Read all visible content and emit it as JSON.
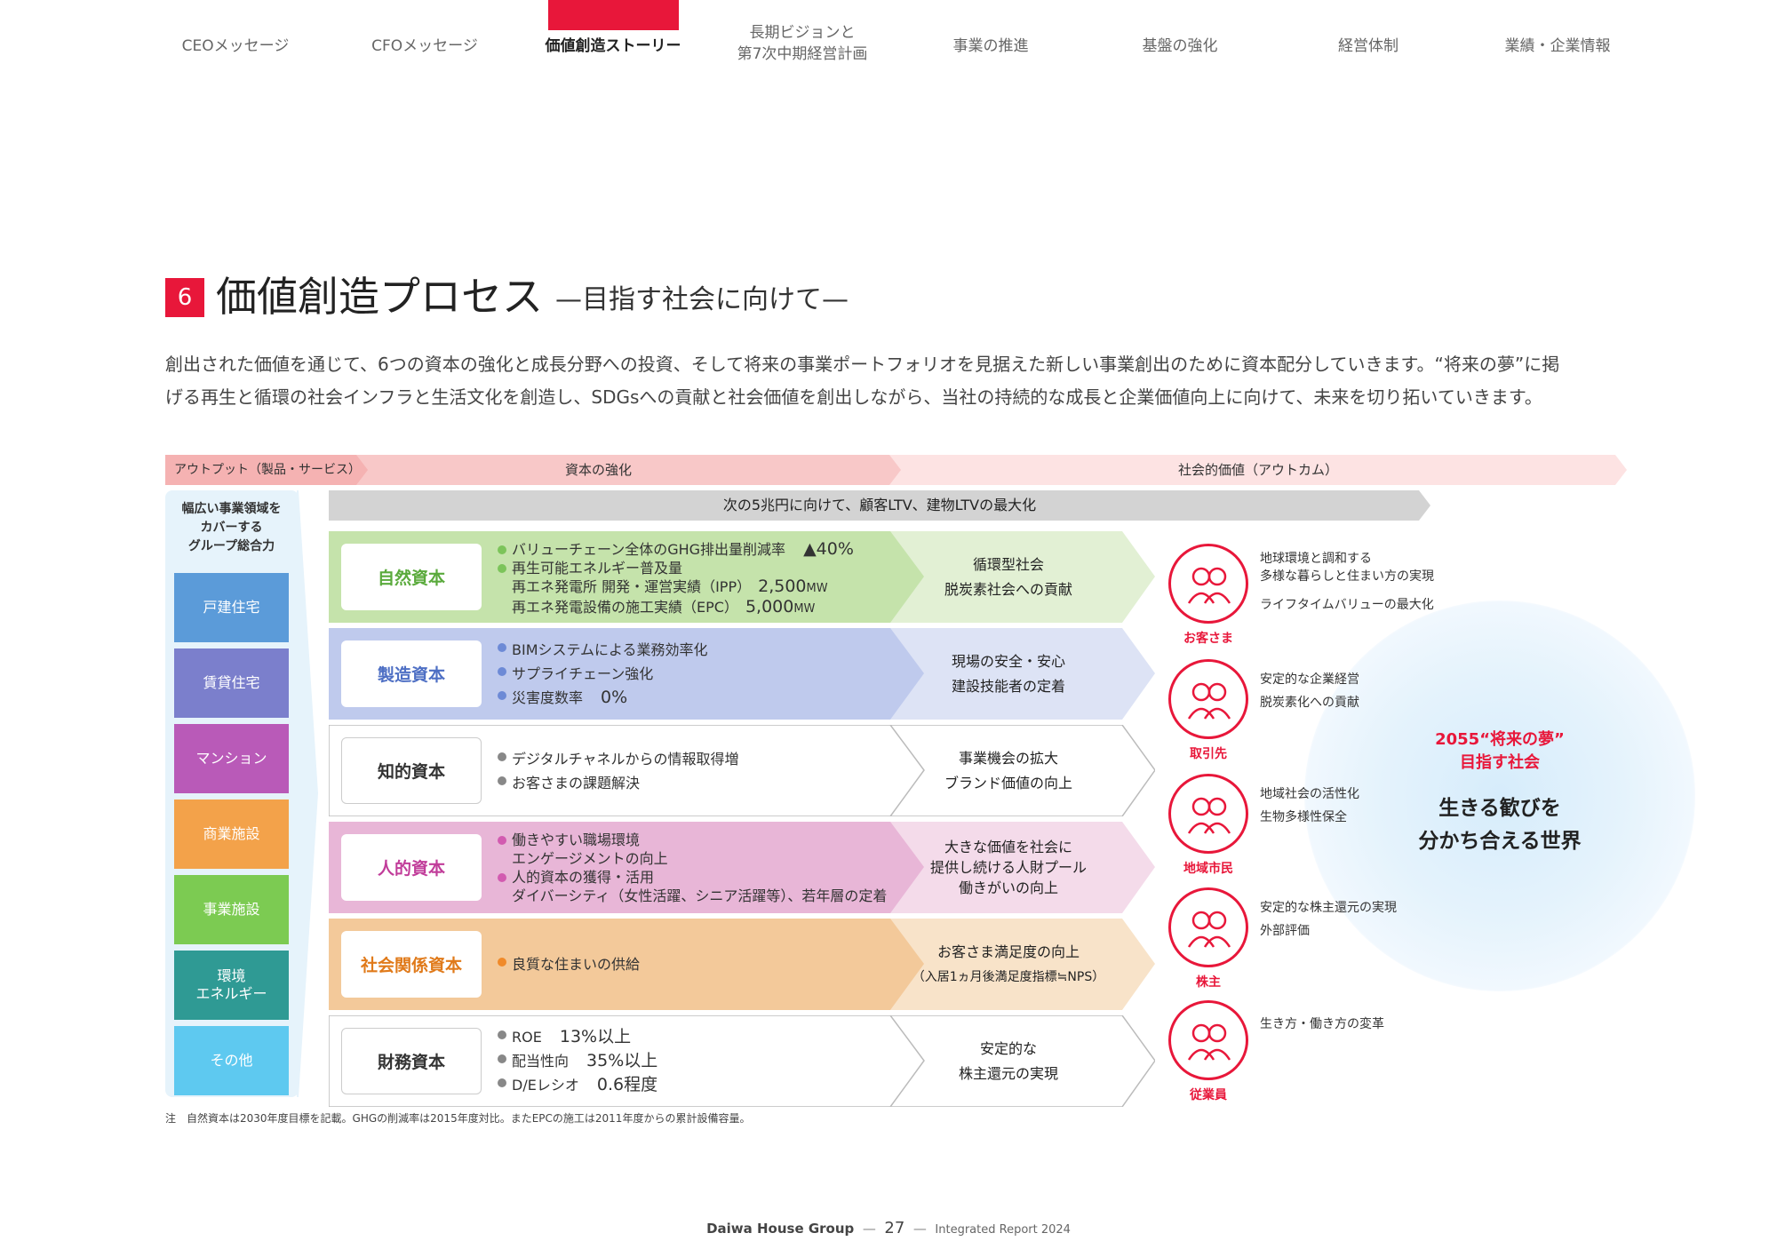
{
  "nav": {
    "items": [
      "CEOメッセージ",
      "CFOメッセージ",
      "価値創造ストーリー",
      "長期ビジョンと",
      "事業の推進",
      "基盤の強化",
      "経営体制",
      "業績・企業情報"
    ],
    "item4_line2": "第7次中期経営計画",
    "active_index": 2
  },
  "section": {
    "number": "6",
    "title": "価値創造プロセス",
    "subtitle": "—目指す社会に向けて—",
    "intro_line1": "創出された価値を通じて、6つの資本の強化と成長分野への投資、そして将来の事業ポートフォリオを見据えた新しい事業創出のために資本配分していきます。“将来の夢”に掲",
    "intro_line2": "げる再生と循環の社会インフラと生活文化を創造し、SDGsへの貢献と社会価値を創出しながら、当社の持続的な成長と企業価値向上に向けて、未来を切り拓いていきます。"
  },
  "header_bar": {
    "output": "アウトプット（製品・サービス）",
    "capital": "資本の強化",
    "social": "社会的価値（アウトカム）"
  },
  "left": {
    "head_line1": "幅広い事業領域を",
    "head_line2": "カバーする",
    "head_line3": "グループ総合力",
    "businesses": [
      {
        "label": "戸建住宅",
        "color": "#5b9bd9"
      },
      {
        "label": "賃貸住宅",
        "color": "#7b7fcc"
      },
      {
        "label": "マンション",
        "color": "#b95ab8"
      },
      {
        "label": "商業施設",
        "color": "#f3a24a"
      },
      {
        "label": "事業施設",
        "color": "#7ccb52"
      },
      {
        "label": "環境",
        "label2": "エネルギー",
        "color": "#2f9a94"
      },
      {
        "label": "その他",
        "color": "#5ec9f0"
      }
    ]
  },
  "ltv_banner": "次の5兆円に向けて、顧客LTV、建物LTVの最大化",
  "rows": [
    {
      "capital": "自然資本",
      "capital_color": "#5aaa3c",
      "fill": "#c5e3ab",
      "fill2": "#e2f0d4",
      "dot": "#7cc45a",
      "items": [
        {
          "text": "バリューチェーン全体のGHG排出量削減率",
          "value": "▲40%"
        },
        {
          "text": "再生可能エネルギー普及量"
        }
      ],
      "subs": [
        {
          "text": "再エネ発電所 開発・運営実績（IPP）",
          "value": "2,500",
          "unit": "MW"
        },
        {
          "text": "再エネ発電設備の施工実績（EPC）",
          "value": "5,000",
          "unit": "MW"
        }
      ],
      "outcome": [
        "循環型社会",
        "脱炭素社会への貢献"
      ]
    },
    {
      "capital": "製造資本",
      "capital_color": "#4e6fc4",
      "fill": "#bfcaed",
      "fill2": "#dde3f5",
      "dot": "#6d8ad6",
      "items": [
        {
          "text": "BIMシステムによる業務効率化"
        },
        {
          "text": "サプライチェーン強化"
        },
        {
          "text": "災害度数率",
          "value": "0%"
        }
      ],
      "subs": [],
      "outcome": [
        "現場の安全・安心",
        "建設技能者の定着"
      ]
    },
    {
      "capital": "知的資本",
      "capital_color": "#333333",
      "fill": "#ffffff",
      "fill2": "#ffffff",
      "dot": "#888888",
      "items": [
        {
          "text": "デジタルチャネルからの情報取得増"
        },
        {
          "text": "お客さまの課題解決"
        }
      ],
      "subs": [],
      "outcome": [
        "事業機会の拡大",
        "ブランド価値の向上"
      ]
    },
    {
      "capital": "人的資本",
      "capital_color": "#c13d9a",
      "fill": "#e8b6d7",
      "fill2": "#f4dbea",
      "dot": "#d25bb0",
      "items": [
        {
          "text": "働きやすい職場環境",
          "sub": "エンゲージメントの向上"
        },
        {
          "text": "人的資本の獲得・活用",
          "sub": "ダイバーシティ（女性活躍、シニア活躍等）、若年層の定着"
        }
      ],
      "subs": [],
      "outcome": [
        "大きな価値を社会に",
        "提供し続ける人財プール",
        "働きがいの向上"
      ]
    },
    {
      "capital": "社会関係資本",
      "capital_color": "#e07a1a",
      "fill": "#f3c99a",
      "fill2": "#f8e3c9",
      "dot": "#f08a2a",
      "items": [
        {
          "text": "良質な住まいの供給"
        }
      ],
      "subs": [],
      "outcome": [
        "お客さま満足度の向上",
        "（入居1ヵ月後満足度指標≒NPS）"
      ]
    },
    {
      "capital": "財務資本",
      "capital_color": "#333333",
      "fill": "#ffffff",
      "fill2": "#ffffff",
      "dot": "#888888",
      "items": [
        {
          "text": "ROE",
          "value": "13%以上"
        },
        {
          "text": "配当性向",
          "value": "35%以上"
        },
        {
          "text": "D/Eレシオ",
          "value": "0.6程度"
        }
      ],
      "subs": [],
      "outcome": [
        "安定的な",
        "株主還元の実現"
      ]
    }
  ],
  "stakeholders": [
    {
      "label": "お客さま",
      "values": [
        "地球環境と調和する",
        "多様な暮らしと住まい方の実現",
        "ライフタイムバリューの最大化"
      ]
    },
    {
      "label": "取引先",
      "values": [
        "安定的な企業経営",
        "脱炭素化への貢献"
      ]
    },
    {
      "label": "地域市民",
      "values": [
        "地域社会の活性化",
        "生物多様性保全"
      ]
    },
    {
      "label": "株主",
      "values": [
        "安定的な株主還元の実現",
        "外部評価"
      ]
    },
    {
      "label": "従業員",
      "values": [
        "生き方・働き方の変革"
      ]
    }
  ],
  "dream": {
    "title1": "2055“将来の夢”",
    "title2": "目指す社会",
    "main1": "生きる歓びを",
    "main2": "分かち合える世界"
  },
  "note": "注　自然資本は2030年度目標を記載。GHGの削減率は2015年度対比。またEPCの施工は2011年度からの累計設備容量。",
  "footer": {
    "company": "Daiwa House Group",
    "page": "27",
    "report": "Integrated Report 2024"
  },
  "colors": {
    "accent": "#e8173a"
  }
}
